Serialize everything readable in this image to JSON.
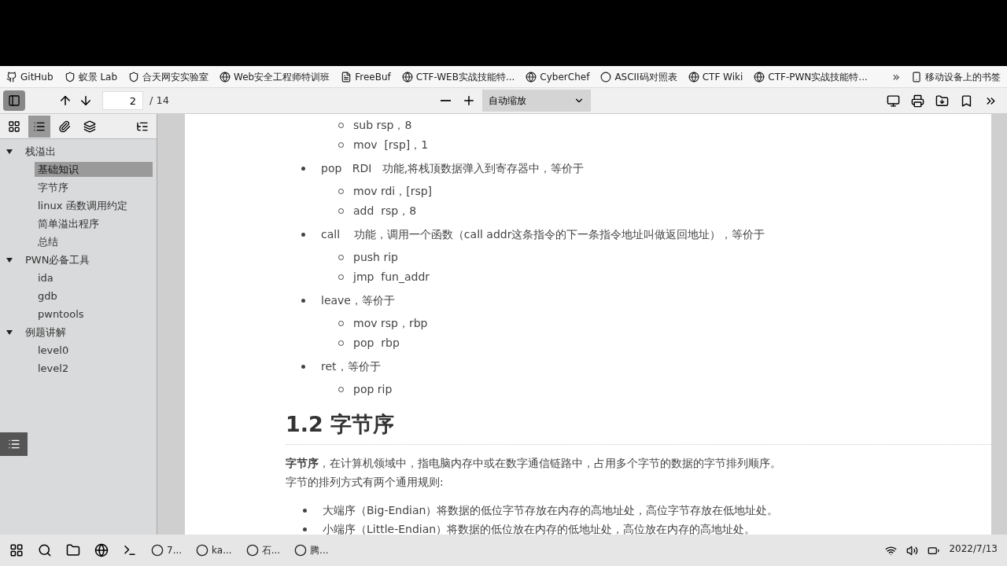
{
  "bookmarks": [
    {
      "label": "GitHub"
    },
    {
      "label": "蚁景 Lab"
    },
    {
      "label": "合天网安实验室"
    },
    {
      "label": "Web安全工程师特训班"
    },
    {
      "label": "FreeBuf"
    },
    {
      "label": "CTF-WEB实战技能特..."
    },
    {
      "label": "CyberChef"
    },
    {
      "label": "ASCII码对照表"
    },
    {
      "label": "CTF Wiki"
    },
    {
      "label": "CTF-PWN实战技能特..."
    }
  ],
  "bookmarks_overflow": "»",
  "mobile_bookmarks": "移动设备上的书签",
  "toolbar": {
    "page": "2",
    "page_total": "/ 14",
    "zoom": "自动缩放",
    "sidebar_open": true
  },
  "sidebar": {
    "items": [
      {
        "label": "栈溢出",
        "expanded": true,
        "selected": false,
        "children": [
          {
            "label": "基础知识",
            "selected": true
          },
          {
            "label": "字节序",
            "selected": false
          },
          {
            "label": "linux 函数调用约定",
            "selected": false
          },
          {
            "label": "简单溢出程序",
            "selected": false
          },
          {
            "label": "总结",
            "selected": false
          }
        ]
      },
      {
        "label": "PWN必备工具",
        "expanded": true,
        "selected": false,
        "children": [
          {
            "label": "ida",
            "selected": false
          },
          {
            "label": "gdb",
            "selected": false
          },
          {
            "label": "pwntools",
            "selected": false
          }
        ]
      },
      {
        "label": "例题讲解",
        "expanded": true,
        "selected": false,
        "children": [
          {
            "label": "level0",
            "selected": false
          },
          {
            "label": "level2",
            "selected": false
          }
        ]
      }
    ]
  },
  "document": [
    {
      "kind": "sublist",
      "items": [
        "sub rsp，8",
        "mov  [rsp]，1"
      ]
    },
    {
      "kind": "bullet",
      "text": "pop   RDI   功能,将栈顶数据弹入到寄存器中，等价于",
      "items": [
        "mov rdi，[rsp]",
        "add  rsp，8"
      ]
    },
    {
      "kind": "bullet",
      "text": "call    功能，调用一个函数（call addr这条指令的下一条指令地址叫做返回地址），等价于",
      "items": [
        "push rip",
        "jmp  fun_addr"
      ]
    },
    {
      "kind": "bullet",
      "text": "leave，等价于",
      "items": [
        "mov rsp，rbp",
        "pop  rbp"
      ]
    },
    {
      "kind": "bullet",
      "text": "ret，等价于",
      "items": [
        "pop rip"
      ]
    },
    {
      "kind": "heading",
      "text": "1.2 字节序"
    },
    {
      "kind": "paragraph",
      "text": "**字节序**，在计算机领域中，指电脑内存中或在数字通信链路中，占用多个字节的数据的字节排列顺序。"
    },
    {
      "kind": "paragraph",
      "text": "字节的排列方式有两个通用规则:"
    },
    {
      "kind": "list",
      "items": [
        "大端序（Big-Endian）将数据的低位字节存放在内存的高地址处，高位字节存放在低地址处。",
        "小端序（Little-Endian）将数据的低位放在内存的低地址处，高位放在内存的高地址处。"
      ]
    }
  ],
  "taskbar": {
    "apps": [
      {
        "label": "7..."
      },
      {
        "label": "ka..."
      },
      {
        "label": "石..."
      },
      {
        "label": "腾..."
      }
    ],
    "date": "2022/7/13"
  }
}
